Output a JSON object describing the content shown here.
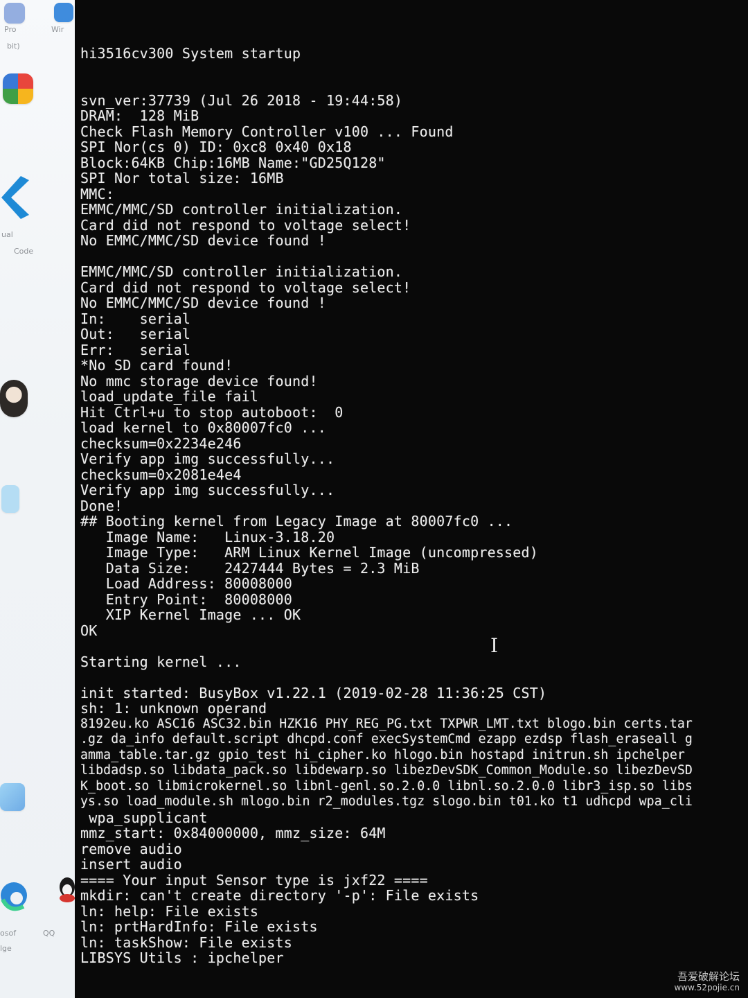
{
  "desktop": {
    "icons": [
      {
        "name": "pro-icon",
        "label": "Pro",
        "sublabel": "bit)",
        "color": "#6b8fd6"
      },
      {
        "name": "wire-icon",
        "label": "Wir",
        "sublabel": "",
        "color": "#1f7ad8"
      },
      {
        "name": "colorful-app-icon",
        "label": "",
        "sublabel": "",
        "color": "#e8453c"
      },
      {
        "name": "vscode-icon",
        "label": "ual",
        "sublabel": "Code",
        "color": "#1e8ad6"
      },
      {
        "name": "cat-icon",
        "label": "",
        "sublabel": "",
        "color": "#2d2926"
      },
      {
        "name": "blue-app-icon",
        "label": "",
        "sublabel": "",
        "color": "#37a7e6"
      },
      {
        "name": "edge-icon",
        "label": "osof",
        "sublabel": "lge",
        "color": "#2d87d8"
      },
      {
        "name": "qq-icon",
        "label": "QQ",
        "sublabel": "",
        "color": "#1a1a1a"
      }
    ]
  },
  "terminal": {
    "lines": [
      "hi3516cv300 System startup",
      "",
      "",
      "svn_ver:37739 (Jul 26 2018 - 19:44:58)",
      "DRAM:  128 MiB",
      "Check Flash Memory Controller v100 ... Found",
      "SPI Nor(cs 0) ID: 0xc8 0x40 0x18",
      "Block:64KB Chip:16MB Name:\"GD25Q128\"",
      "SPI Nor total size: 16MB",
      "MMC:",
      "EMMC/MMC/SD controller initialization.",
      "Card did not respond to voltage select!",
      "No EMMC/MMC/SD device found !",
      "",
      "EMMC/MMC/SD controller initialization.",
      "Card did not respond to voltage select!",
      "No EMMC/MMC/SD device found !",
      "In:    serial",
      "Out:   serial",
      "Err:   serial",
      "*No SD card found!",
      "No mmc storage device found!",
      "load_update_file fail",
      "Hit Ctrl+u to stop autoboot:  0",
      "load kernel to 0x80007fc0 ...",
      "checksum=0x2234e246",
      "Verify app img successfully...",
      "checksum=0x2081e4e4",
      "Verify app img successfully...",
      "Done!",
      "## Booting kernel from Legacy Image at 80007fc0 ...",
      "   Image Name:   Linux-3.18.20",
      "   Image Type:   ARM Linux Kernel Image (uncompressed)",
      "   Data Size:    2427444 Bytes = 2.3 MiB",
      "   Load Address: 80008000",
      "   Entry Point:  80008000",
      "   XIP Kernel Image ... OK",
      "OK",
      "",
      "Starting kernel ...",
      "",
      "init started: BusyBox v1.22.1 (2019-02-28 11:36:25 CST)",
      "sh: 1: unknown operand",
      "8192eu.ko ASC16 ASC32.bin HZK16 PHY_REG_PG.txt TXPWR_LMT.txt blogo.bin certs.tar",
      ".gz da_info default.script dhcpd.conf execSystemCmd ezapp ezdsp flash_eraseall g",
      "amma_table.tar.gz gpio_test hi_cipher.ko hlogo.bin hostapd initrun.sh ipchelper",
      "libdadsp.so libdata_pack.so libdewarp.so libezDevSDK_Common_Module.so libezDevSD",
      "K_boot.so libmicrokernel.so libnl-genl.so.2.0.0 libnl.so.2.0.0 libr3_isp.so libs",
      "ys.so load_module.sh mlogo.bin r2_modules.tgz slogo.bin t01.ko t1 udhcpd wpa_cli",
      " wpa_supplicant",
      "mmz_start: 0x84000000, mmz_size: 64M",
      "remove audio",
      "insert audio",
      "==== Your input Sensor type is jxf22 ====",
      "mkdir: can't create directory '-p': File exists",
      "ln: help: File exists",
      "ln: prtHardInfo: File exists",
      "ln: taskShow: File exists",
      "LIBSYS Utils : ipchelper"
    ]
  },
  "cursor_glyph": "I",
  "watermark": {
    "title": "吾爱破解论坛",
    "url": "www.52pojie.cn"
  }
}
